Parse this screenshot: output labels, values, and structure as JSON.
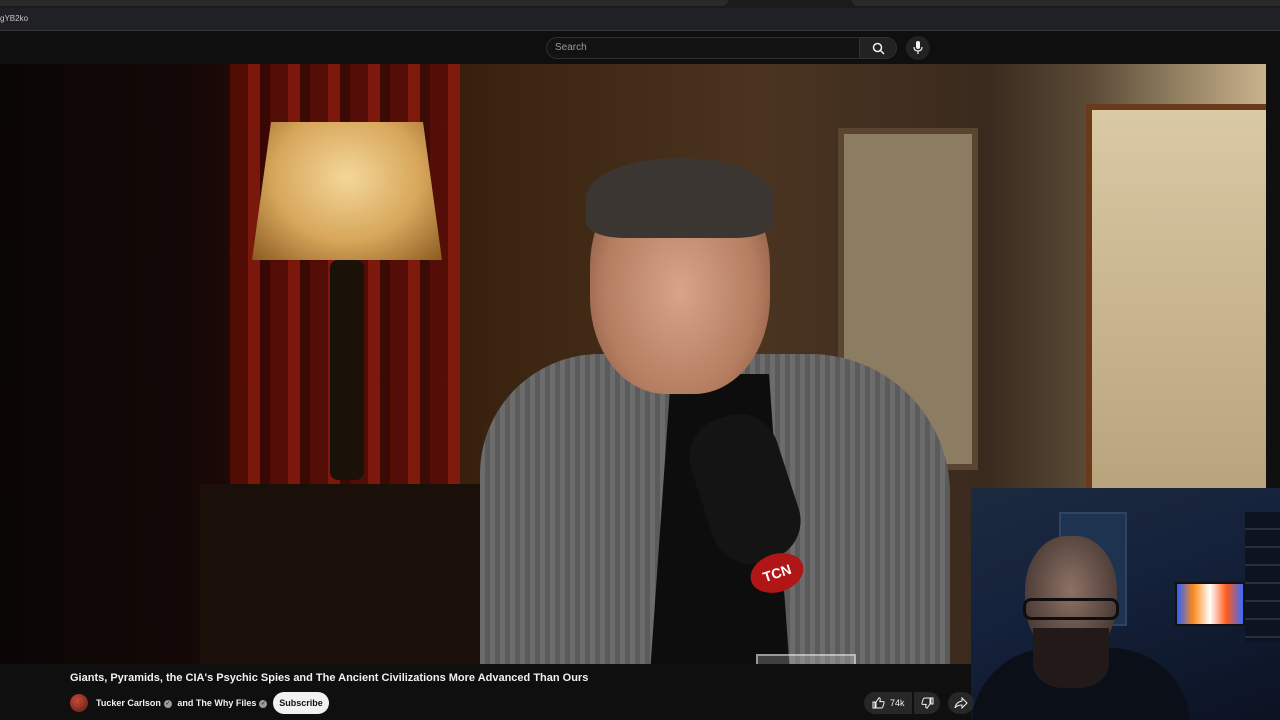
{
  "browser": {
    "url_fragment": "gYB2ko"
  },
  "search": {
    "placeholder": "Search"
  },
  "video": {
    "title": "Giants, Pyramids, the CIA's Psychic Spies and The Ancient Civilizations More Advanced Than Ours",
    "mic_logo": "TCN"
  },
  "owner": {
    "channel_1": "Tucker Carlson",
    "joiner": "and",
    "channel_2": "The Why Files",
    "subscribe_label": "Subscribe"
  },
  "actions": {
    "like_count": "74k"
  },
  "colors": {
    "background": "#0f0f0f",
    "text": "#f1f1f1",
    "button_bg": "#272727",
    "subscribe_bg": "#f1f1f1"
  },
  "icons": [
    "search-icon",
    "mic-icon",
    "verified-icon",
    "like-icon",
    "dislike-icon",
    "share-icon"
  ]
}
